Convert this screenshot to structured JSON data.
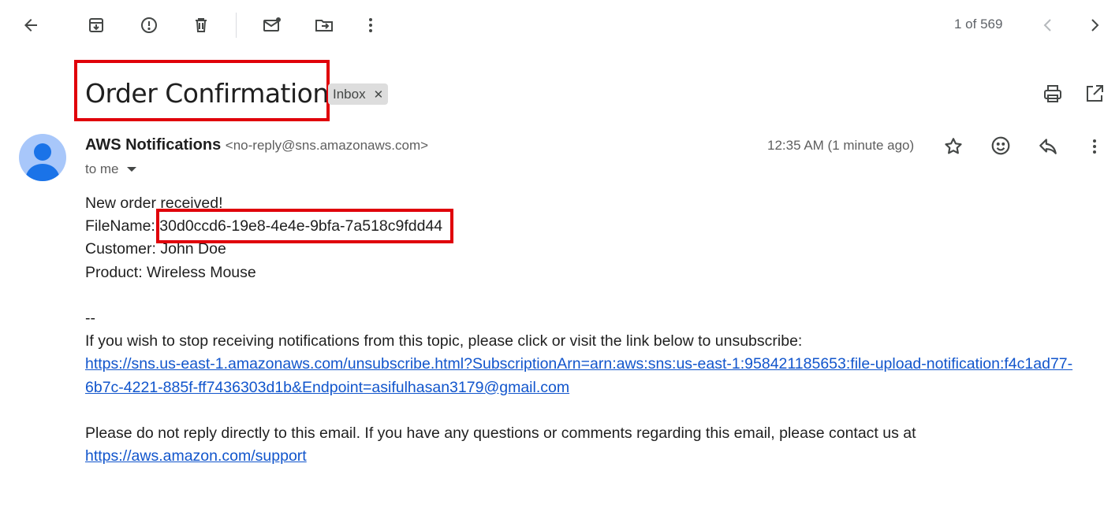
{
  "toolbar": {
    "pager": "1 of 569"
  },
  "email": {
    "subject": "Order Confirmation",
    "label": "Inbox",
    "sender_name": "AWS Notifications",
    "sender_address": "<no-reply@sns.amazonaws.com>",
    "recipient": "to me",
    "timestamp": "12:35 AM (1 minute ago)",
    "body": {
      "line1": "New order received!",
      "filename_label": "FileName: ",
      "filename_value": "30d0ccd6-19e8-4e4e-9bfa-7a518c9fdd44",
      "customer": "Customer: John Doe",
      "product": "Product: Wireless Mouse",
      "separator": "--",
      "unsubscribe_text": "If you wish to stop receiving notifications from this topic, please click or visit the link below to unsubscribe:",
      "unsubscribe_link_line1": "https://sns.us-east-1.amazonaws.com/unsubscribe.html?SubscriptionArn=arn:aws:sns:us-east-1:958421185653:file-upload-notification:f4c1ad77-",
      "unsubscribe_link_line2": "6b7c-4221-885f-ff7436303d1b&Endpoint=asifulhasan3179@gmail.com",
      "noreply_text": "Please do not reply directly to this email. If you have any questions or comments regarding this email, please contact us at",
      "support_link": "https://aws.amazon.com/support"
    }
  },
  "colors": {
    "highlight": "#e0000a",
    "link": "#1155cc",
    "avatar_bg": "#a8c7fa",
    "avatar_fg": "#1a73e8"
  }
}
